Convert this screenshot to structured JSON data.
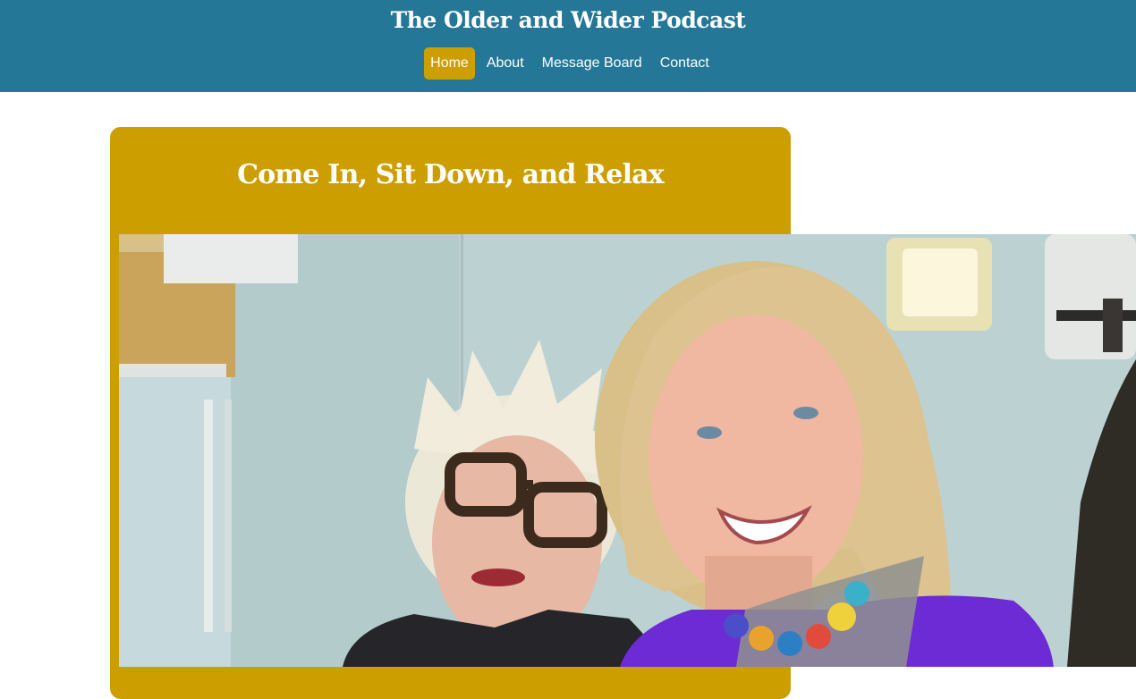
{
  "header": {
    "title": "The Older and Wider Podcast",
    "background_color": "#247797"
  },
  "nav": {
    "items": [
      {
        "label": "Home",
        "active": true
      },
      {
        "label": "About",
        "active": false
      },
      {
        "label": "Message Board",
        "active": false
      },
      {
        "label": "Contact",
        "active": false
      }
    ],
    "active_color": "#cc9e00"
  },
  "hero": {
    "heading": "Come In, Sit Down, and Relax",
    "card_color": "#cc9e00",
    "photo": "two smiling women posing together in a room"
  }
}
